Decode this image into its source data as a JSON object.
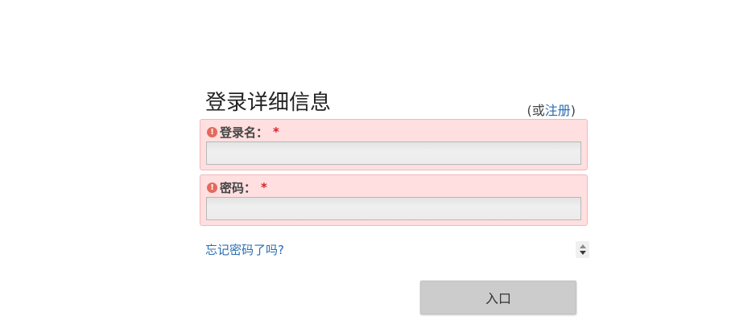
{
  "form": {
    "title": "登录详细信息",
    "alt_prefix": "(或",
    "alt_link": "注册",
    "alt_suffix": ")",
    "username": {
      "error_icon": "!",
      "label": "登录名：",
      "required_mark": "*",
      "value": "",
      "placeholder": ""
    },
    "password": {
      "error_icon": "!",
      "label": "密码：",
      "required_mark": "*",
      "value": "",
      "placeholder": ""
    },
    "forgot_password": "忘记密码了吗?",
    "submit_label": "入口"
  },
  "colors": {
    "error_background": "#ffdfe0",
    "error_border": "#f3b7ba",
    "link": "#2a6db0",
    "required": "#d9202a",
    "button_background": "#cccccc"
  }
}
